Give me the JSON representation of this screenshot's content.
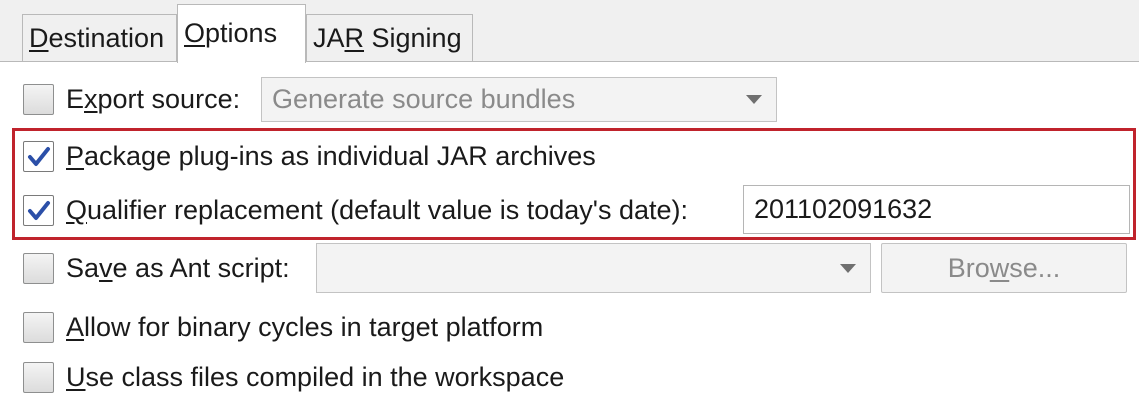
{
  "tabs": [
    {
      "pre": "",
      "key": "D",
      "post": "estination",
      "active": false
    },
    {
      "pre": "",
      "key": "O",
      "post": "ptions",
      "active": true
    },
    {
      "pre": "JA",
      "key": "R",
      "post": " Signing",
      "active": false
    }
  ],
  "export_source": {
    "checked": false,
    "label_pre": "E",
    "label_key": "x",
    "label_post": "port source:",
    "combo_value": "Generate source bundles"
  },
  "package_plugins": {
    "checked": true,
    "label_pre": "",
    "label_key": "P",
    "label_post": "ackage plug-ins as individual JAR archives"
  },
  "qualifier": {
    "checked": true,
    "label_pre": "",
    "label_key": "Q",
    "label_post": "ualifier replacement (default value is today's date):",
    "value": "201102091632"
  },
  "ant_script": {
    "checked": false,
    "label_pre": "Sa",
    "label_key": "v",
    "label_post": "e as Ant script:",
    "combo_value": "",
    "browse_pre": "Bro",
    "browse_key": "w",
    "browse_post": "se..."
  },
  "binary_cycles": {
    "checked": false,
    "label_pre": "",
    "label_key": "A",
    "label_post": "llow for binary cycles in target platform"
  },
  "class_files": {
    "checked": false,
    "label_pre": "",
    "label_key": "U",
    "label_post": "se class files compiled in the workspace"
  },
  "colors": {
    "highlight": "#c0232c",
    "checkmark": "#2b4fa8"
  }
}
